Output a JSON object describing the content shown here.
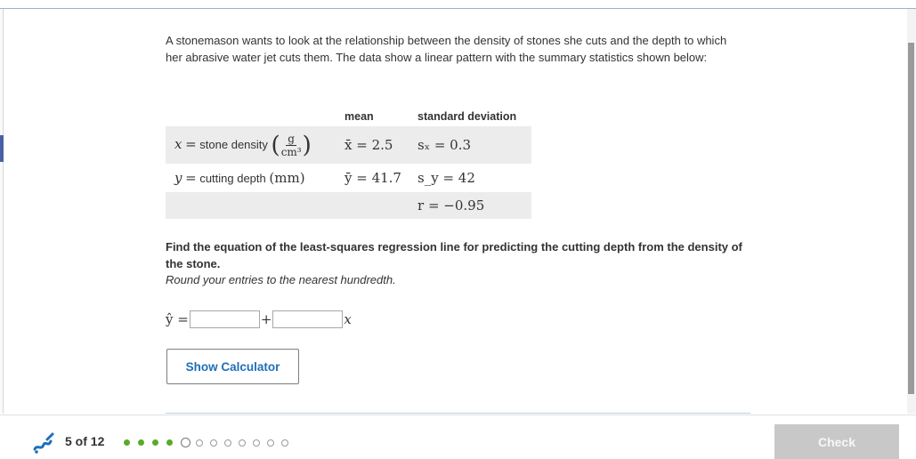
{
  "problem": {
    "intro": "A stonemason wants to look at the relationship between the density of stones she cuts and the depth to which her abrasive water jet cuts them. The data show a linear pattern with the summary statistics shown below:",
    "table": {
      "headers": [
        "",
        "mean",
        "standard deviation"
      ],
      "x_row": {
        "var": "x",
        "eq": "=",
        "label": "stone density",
        "unit_num": "g",
        "unit_den": "cm³",
        "mean": "x̄ = 2.5",
        "sd": "sₓ = 0.3"
      },
      "y_row": {
        "var": "y",
        "eq": "=",
        "label": "cutting depth",
        "unit": "(mm)",
        "mean": "ȳ = 41.7",
        "sd": "s_y = 42"
      },
      "r_row": {
        "r": "r = −0.95"
      }
    },
    "question": "Find the equation of the least-squares regression line for predicting the cutting depth from the density of the stone.",
    "hint": "Round your entries to the nearest hundredth.",
    "equation": {
      "lhs": "ŷ =",
      "plus": "+",
      "x": "x",
      "intercept_value": "",
      "slope_value": ""
    },
    "calculator_button": "Show Calculator"
  },
  "footer": {
    "progress": "5 of 12",
    "completed": 4,
    "total": 12,
    "check_button": "Check",
    "accent_color": "#5aaa2a"
  },
  "icons": {
    "logo": "khan-pencil-logo-icon"
  }
}
